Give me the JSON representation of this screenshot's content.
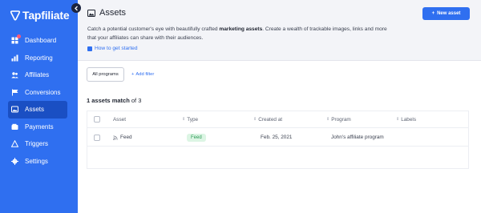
{
  "app": {
    "brand": "Tapfiliate"
  },
  "sidebar": {
    "items": [
      {
        "label": "Dashboard",
        "icon": "dashboard-icon",
        "badge": true
      },
      {
        "label": "Reporting",
        "icon": "bar-chart-icon"
      },
      {
        "label": "Affiliates",
        "icon": "users-icon"
      },
      {
        "label": "Conversions",
        "icon": "flag-icon"
      },
      {
        "label": "Assets",
        "icon": "image-icon",
        "active": true
      },
      {
        "label": "Payments",
        "icon": "wallet-icon"
      },
      {
        "label": "Triggers",
        "icon": "warning-icon"
      },
      {
        "label": "Settings",
        "icon": "gear-icon"
      }
    ],
    "colors": {
      "background": "#2f6ff0",
      "active": "#1a4fc3"
    }
  },
  "header": {
    "title": "Assets",
    "new_asset_label": "New asset",
    "description_pre": "Catch a potential customer's eye with beautifully crafted ",
    "description_bold": "marketing assets",
    "description_post": ". Create a wealth of trackable images, links and more that your affiliates can share with their audiences.",
    "how_link": "How to get started"
  },
  "filters": {
    "all_programs": "All programs",
    "add_filter": "Add filter"
  },
  "results": {
    "count": "1 assets match",
    "of_total": "of 3"
  },
  "table": {
    "columns": [
      "Asset",
      "Type",
      "Created at",
      "Program",
      "Labels"
    ],
    "rows": [
      {
        "asset": "Feed",
        "type": "Feed",
        "created_at": "Feb. 25, 2021",
        "program": "John's affiliate program",
        "labels": ""
      }
    ]
  }
}
